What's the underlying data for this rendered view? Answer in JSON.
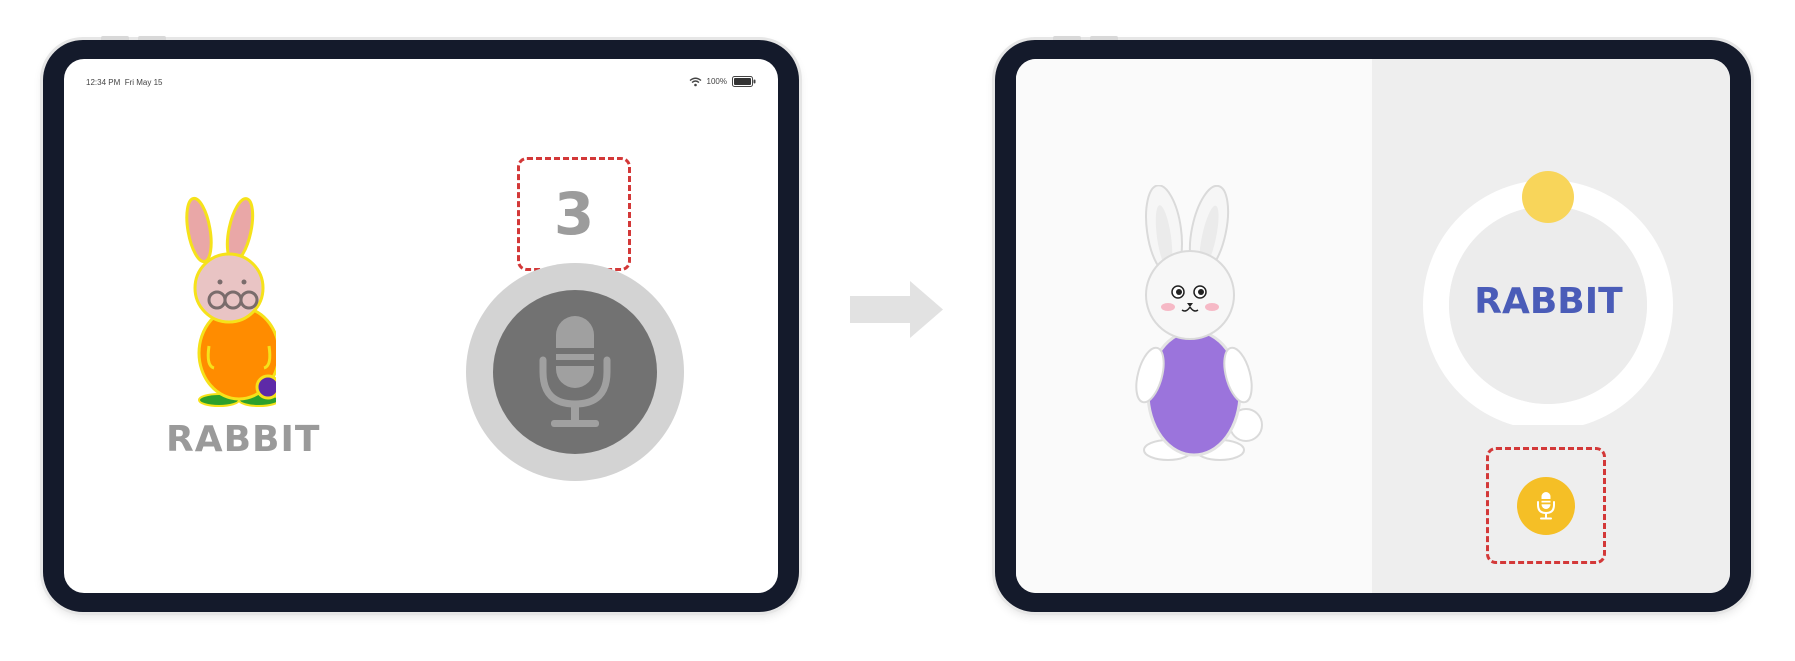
{
  "left_tablet": {
    "status_bar": {
      "time": "12:34 PM",
      "date": "Fri May 15",
      "battery": "100%",
      "icons": [
        "wifi-icon",
        "battery-icon"
      ]
    },
    "word": "RABBIT",
    "countdown": "3",
    "mic_icon": "microphone-icon"
  },
  "transition_icon": "right-arrow-icon",
  "right_tablet": {
    "word": "RABBIT",
    "record_icon": "microphone-icon",
    "progress_indicator": "yellow dot at top of ring"
  },
  "colors": {
    "tablet_frame": "#141a2b",
    "highlight_dashed": "#d33838",
    "word_gray": "#9a9a9a",
    "word_blue": "#4a5cb8",
    "accent_yellow": "#f5bf26",
    "mic_dark": "#727272",
    "mic_ring": "#d3d3d3",
    "bunny_body_orange": "#ff8c00",
    "bunny_body_purple": "#9b74dc"
  }
}
